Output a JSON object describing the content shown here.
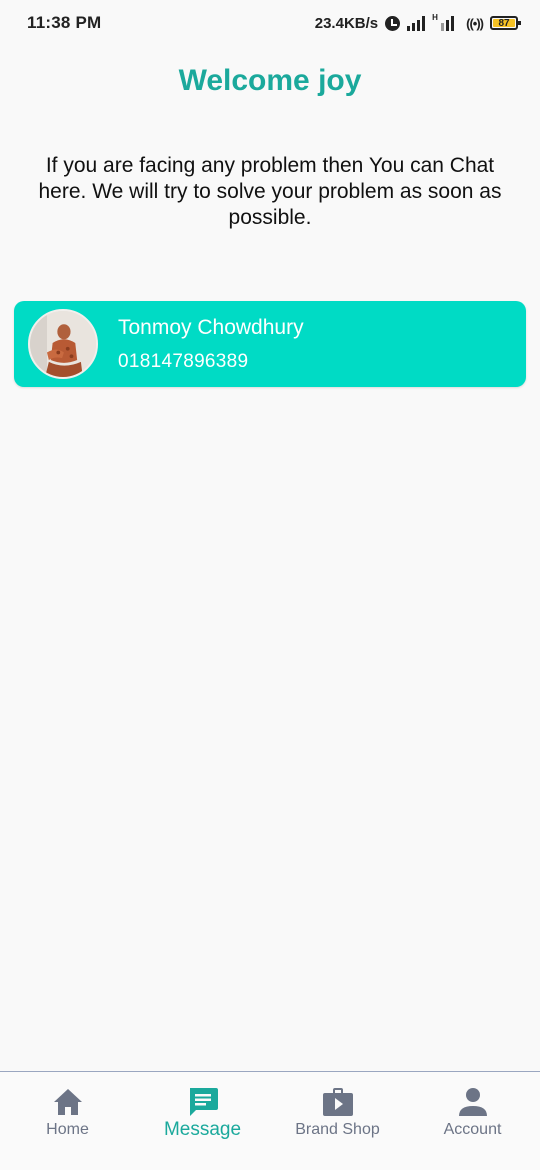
{
  "status_bar": {
    "time": "11:38 PM",
    "network_speed": "23.4KB/s",
    "battery_level": "87",
    "icons": [
      "alarm-icon",
      "signal-icon",
      "signal-h-icon",
      "hotspot-icon",
      "battery-icon"
    ]
  },
  "header": {
    "title": "Welcome joy",
    "intro": "If you are facing any problem then You can Chat here. We will try to solve your problem as soon as possible."
  },
  "chats": [
    {
      "name": "Tonmoy Chowdhury",
      "phone": "018147896389",
      "avatar": "avatar-photo"
    }
  ],
  "bottom_nav": {
    "items": [
      {
        "label": "Home",
        "icon": "home-icon",
        "active": false
      },
      {
        "label": "Message",
        "icon": "message-icon",
        "active": true
      },
      {
        "label": "Brand Shop",
        "icon": "brand-shop-icon",
        "active": false
      },
      {
        "label": "Account",
        "icon": "account-icon",
        "active": false
      }
    ]
  },
  "colors": {
    "accent": "#1ba99c",
    "card": "#00dbc5",
    "nav_inactive": "#6c7486",
    "background": "#f9f9f9"
  }
}
